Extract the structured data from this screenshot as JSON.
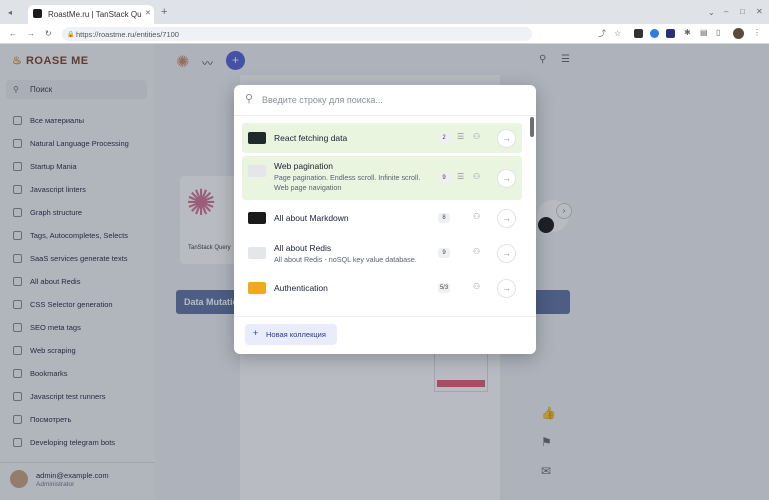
{
  "browser": {
    "tab_title": "RoastMe.ru | TanStack Qu",
    "url": "https://roastme.ru/entities/7100"
  },
  "sidebar": {
    "logo": "ROASE ME",
    "search_placeholder": "Поиск",
    "items": [
      {
        "label": "Все материалы"
      },
      {
        "label": "Natural Language Processing"
      },
      {
        "label": "Startup Mania"
      },
      {
        "label": "Javascript linters"
      },
      {
        "label": "Graph structure"
      },
      {
        "label": "Tags, Autocompletes, Selects"
      },
      {
        "label": "SaaS services generate texts"
      },
      {
        "label": "All about Redis"
      },
      {
        "label": "CSS Selector generation"
      },
      {
        "label": "SEO meta tags"
      },
      {
        "label": "Web scraping"
      },
      {
        "label": "Bookmarks"
      },
      {
        "label": "Javascript test runners"
      },
      {
        "label": "Посмотреть"
      },
      {
        "label": "Developing telegram bots"
      }
    ],
    "user": {
      "email": "admin@example.com",
      "role": "Administrator"
    }
  },
  "main": {
    "card_caption": "TanStack Query",
    "bluebar_label": "Data Mutation"
  },
  "modal": {
    "search_placeholder": "Введите строку для поиска...",
    "new_collection_label": "Новая коллекция",
    "results": [
      {
        "title": "React fetching data",
        "desc": "",
        "count": "2",
        "highlighted": true,
        "thumb": "react"
      },
      {
        "title": "Web pagination",
        "desc": "Page pagination. Endless scroll. Infinite scroll. Web page navigation",
        "count": "9",
        "highlighted": true,
        "thumb": "image"
      },
      {
        "title": "All about Markdown",
        "desc": "",
        "count": "8",
        "highlighted": false,
        "thumb": "markdown"
      },
      {
        "title": "All about Redis",
        "desc": "All about Redis - noSQL key value database.",
        "count": "9",
        "highlighted": false,
        "thumb": "image"
      },
      {
        "title": "Authentication",
        "desc": "",
        "count": "5/3",
        "highlighted": false,
        "thumb": "auth"
      }
    ]
  },
  "colors": {
    "accent": "#4f5bd5",
    "highlight": "#eaf5e0",
    "logo": "#7a3a1f"
  }
}
